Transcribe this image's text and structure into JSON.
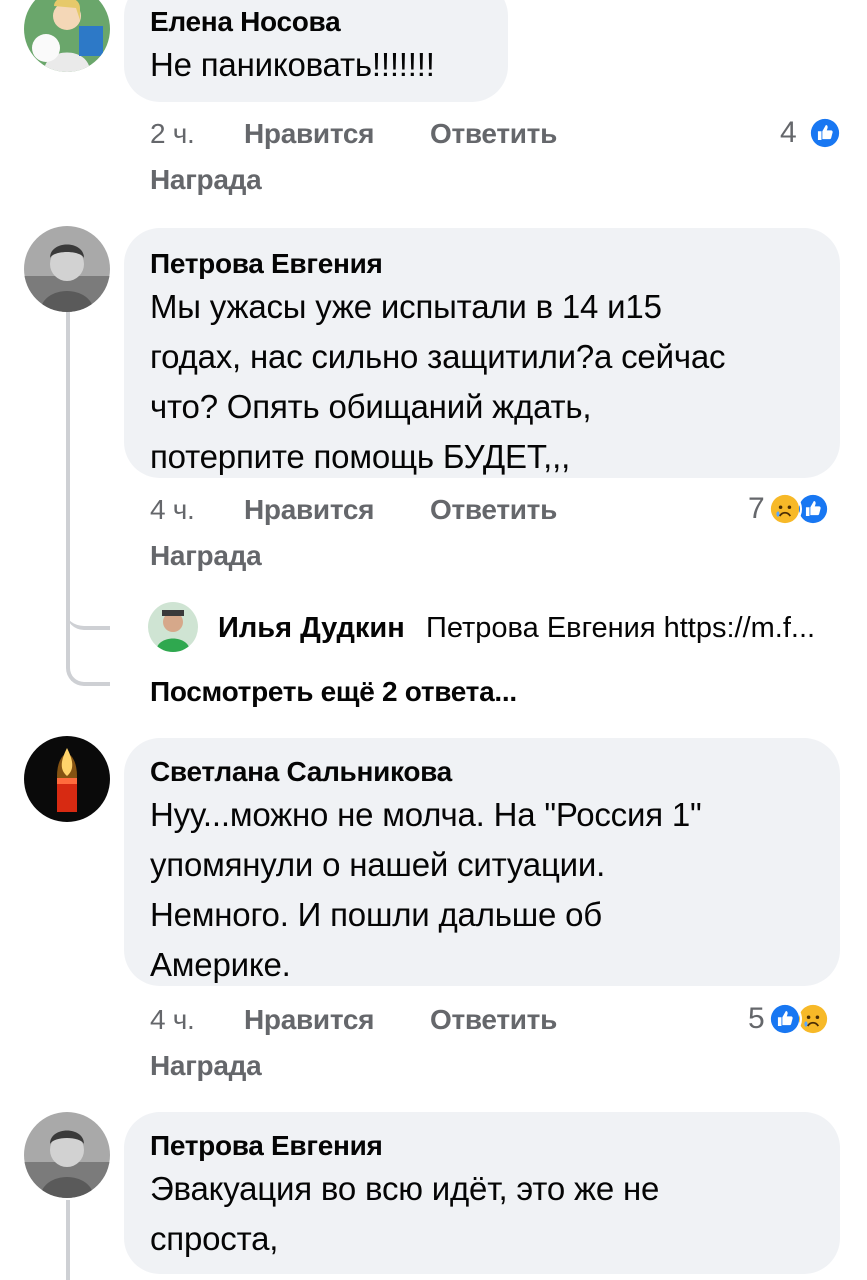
{
  "comments": [
    {
      "author": "Елена Носова",
      "text": "Не паниковать!!!!!!!",
      "time": "2 ч.",
      "like": "Нравится",
      "reply": "Ответить",
      "award": "Награда",
      "reaction_count": "4",
      "reactions": [
        "like-icon"
      ]
    },
    {
      "author": "Петрова Евгения",
      "text": "Мы ужасы уже испытали в 14 и15\nгодах, нас сильно защитили?а сейчас\nчто? Опять обищаний ждать,\nпотерпите помощь БУДЕТ,,,",
      "time": "4 ч.",
      "like": "Нравится",
      "reply": "Ответить",
      "award": "Награда",
      "reaction_count": "7",
      "reactions": [
        "sad-icon",
        "like-icon"
      ],
      "replies": {
        "first": {
          "author": "Илья Дудкин",
          "text": "Петрова Евгения https://m.f..."
        },
        "more": "Посмотреть ещё 2 ответа..."
      }
    },
    {
      "author": "Светлана Сальникова",
      "text": "Нуу...можно не молча. На \"Россия 1\"\nупомянули о нашей ситуации.\nНемного. И пошли дальше об\nАмерике.",
      "time": "4 ч.",
      "like": "Нравится",
      "reply": "Ответить",
      "award": "Награда",
      "reaction_count": "5",
      "reactions": [
        "like-icon",
        "sad-icon"
      ]
    },
    {
      "author": "Петрова Евгения",
      "text": "Эвакуация во всю идёт, это же не\nспроста,"
    }
  ],
  "colors": {
    "bubble": "#f0f2f5",
    "meta_text": "#65676b",
    "like_blue": "#1877f2",
    "sad_yellow": "#f7b928"
  }
}
